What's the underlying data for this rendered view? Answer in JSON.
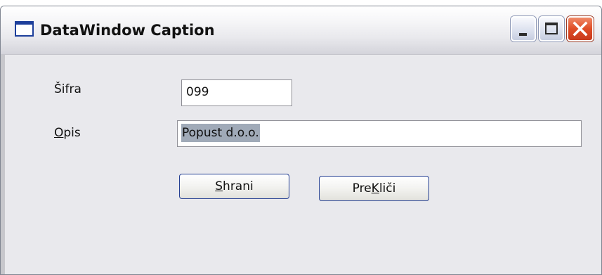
{
  "window": {
    "title": "DataWindow Caption",
    "icon": "window-icon",
    "controls": {
      "minimize": "minimize-icon",
      "maximize": "maximize-icon",
      "close": "close-icon",
      "close_color": "#df4d26"
    }
  },
  "form": {
    "sifra": {
      "label": "Šifra",
      "value": "099"
    },
    "opis": {
      "label_mnemonic": "O",
      "label_rest": "pis",
      "value": "Popust d.o.o."
    }
  },
  "buttons": {
    "save": {
      "mnemonic": "S",
      "rest": "hrani"
    },
    "cancel": {
      "prefix": "Pre",
      "mnemonic": "K",
      "rest": "liči"
    }
  },
  "colors": {
    "client_bg": "#e9e9ed",
    "selection": "#a0aab8",
    "button_border": "#233e92"
  }
}
